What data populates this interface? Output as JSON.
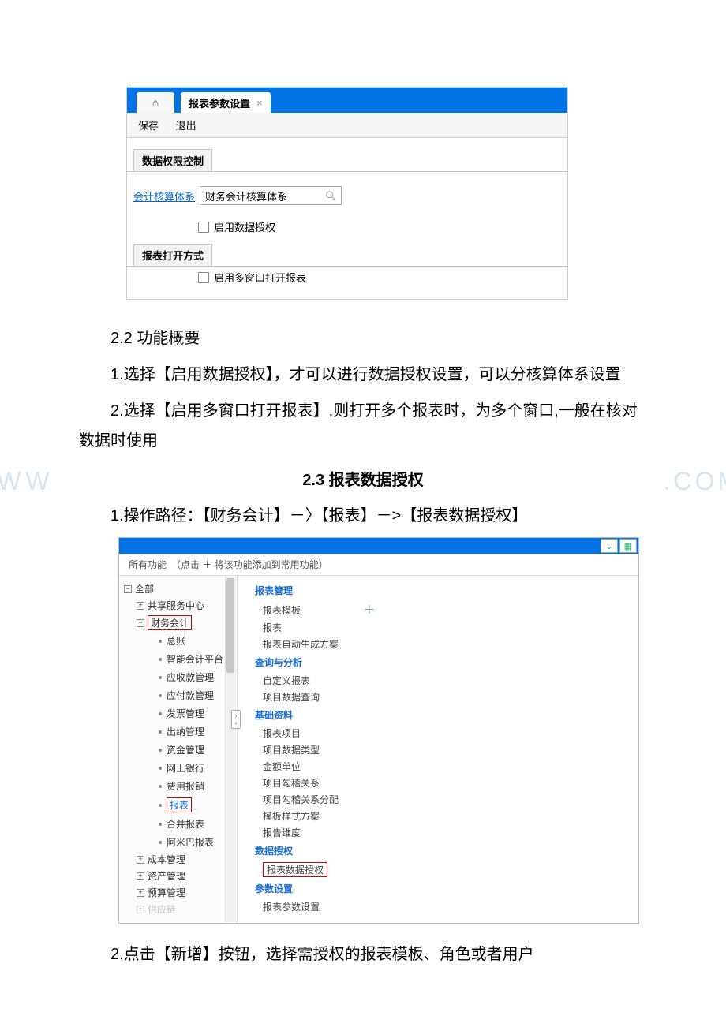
{
  "shot1": {
    "tab_title": "报表参数设置",
    "tab_close": "×",
    "home_glyph": "⌂",
    "toolbar": {
      "save": "保存",
      "exit": "退出"
    },
    "sec1": "数据权限控制",
    "field1_label": "会计核算体系",
    "field1_value": "财务会计核算体系",
    "chk1": "启用数据授权",
    "sec2": "报表打开方式",
    "chk2": "启用多窗口打开报表"
  },
  "doc": {
    "p1": "2.2 功能概要",
    "p2": "1.选择【启用数据授权】，才可以进行数据授权设置，可以分核算体系设置",
    "p3": "2.选择【启用多窗口打开报表】,则打开多个报表时，为多个窗口,一般在核对数据时使用",
    "h3": "2.3 报表数据授权",
    "wm_left": "WWW",
    "wm_right": ".COM",
    "p4": "1.操作路径：【财务会计】－〉【报表】－>【报表数据授权】",
    "p5": "2.点击【新增】按钮，选择需授权的报表模板、角色或者用户"
  },
  "shot2": {
    "subbar": "所有功能　（点击 ＋ 将该功能添加到常用功能）",
    "expand_glyph": "⌄",
    "grid_glyph": "▦",
    "toggle_r": "›",
    "toggle_l": "‹",
    "tree": {
      "root": "全部",
      "n1": "共享服务中心",
      "n2": "财务会计",
      "c1": "总账",
      "c2": "智能会计平台",
      "c3": "应收款管理",
      "c4": "应付款管理",
      "c5": "发票管理",
      "c6": "出纳管理",
      "c7": "资金管理",
      "c8": "网上银行",
      "c9": "费用报销",
      "c10": "报表",
      "c11": "合并报表",
      "c12": "阿米巴报表",
      "n3": "成本管理",
      "n4": "资产管理",
      "n5": "预算管理",
      "n6": "供应链"
    },
    "menu": {
      "g1": "报表管理",
      "g1i1": "报表模板",
      "g1i2": "报表",
      "g1i3": "报表自动生成方案",
      "g2": "查询与分析",
      "g2i1": "自定义报表",
      "g2i2": "项目数据查询",
      "g3": "基础资料",
      "g3i1": "报表项目",
      "g3i2": "项目数据类型",
      "g3i3": "金额单位",
      "g3i4": "项目勾稽关系",
      "g3i5": "项目勾稽关系分配",
      "g3i6": "模板样式方案",
      "g3i7": "报告维度",
      "g4": "数据授权",
      "g4i1": "报表数据授权",
      "g5": "参数设置",
      "g5i1": "报表参数设置",
      "plus": "＋"
    }
  }
}
